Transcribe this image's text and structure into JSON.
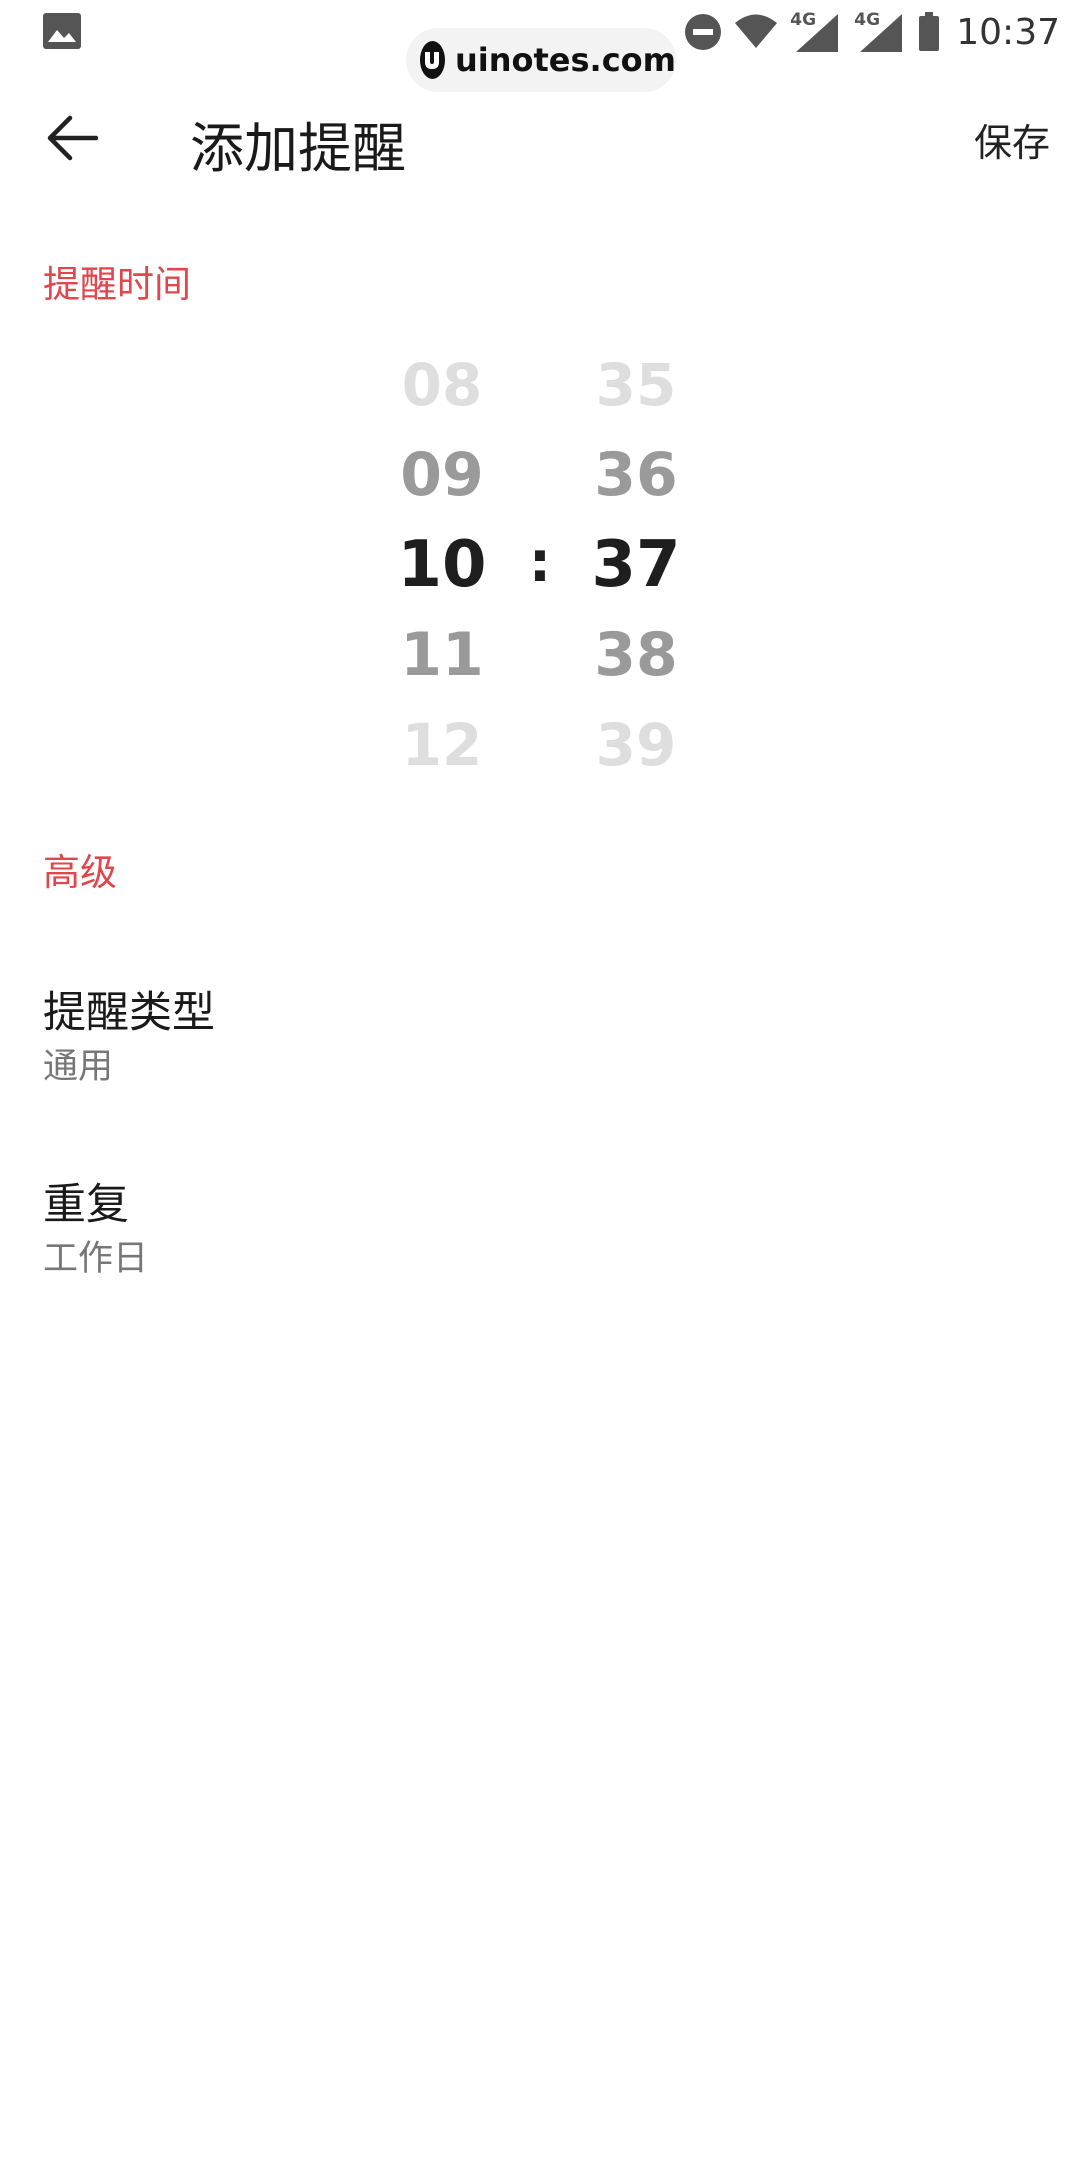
{
  "status_bar": {
    "time": "10:37",
    "network_1": "4G",
    "network_2": "4G",
    "icons": [
      "gallery-icon",
      "dnd-icon",
      "wifi-icon",
      "signal-icon",
      "signal-icon",
      "battery-icon"
    ]
  },
  "watermark": {
    "text": "uinotes.com"
  },
  "app_bar": {
    "title": "添加提醒",
    "save_label": "保存",
    "back_icon": "arrow-left-icon"
  },
  "sections": {
    "time_header": "提醒时间",
    "advanced_header": "高级"
  },
  "time_picker": {
    "hours": [
      "08",
      "09",
      "10",
      "11",
      "12"
    ],
    "minutes": [
      "35",
      "36",
      "37",
      "38",
      "39"
    ],
    "selected_hour": "10",
    "selected_minute": "37",
    "separator": ":"
  },
  "settings": {
    "reminder_type": {
      "title": "提醒类型",
      "value": "通用"
    },
    "repeat": {
      "title": "重复",
      "value": "工作日"
    }
  },
  "colors": {
    "accent": "#e0464b",
    "text_primary": "#1a1a1a",
    "text_secondary": "#777777"
  }
}
